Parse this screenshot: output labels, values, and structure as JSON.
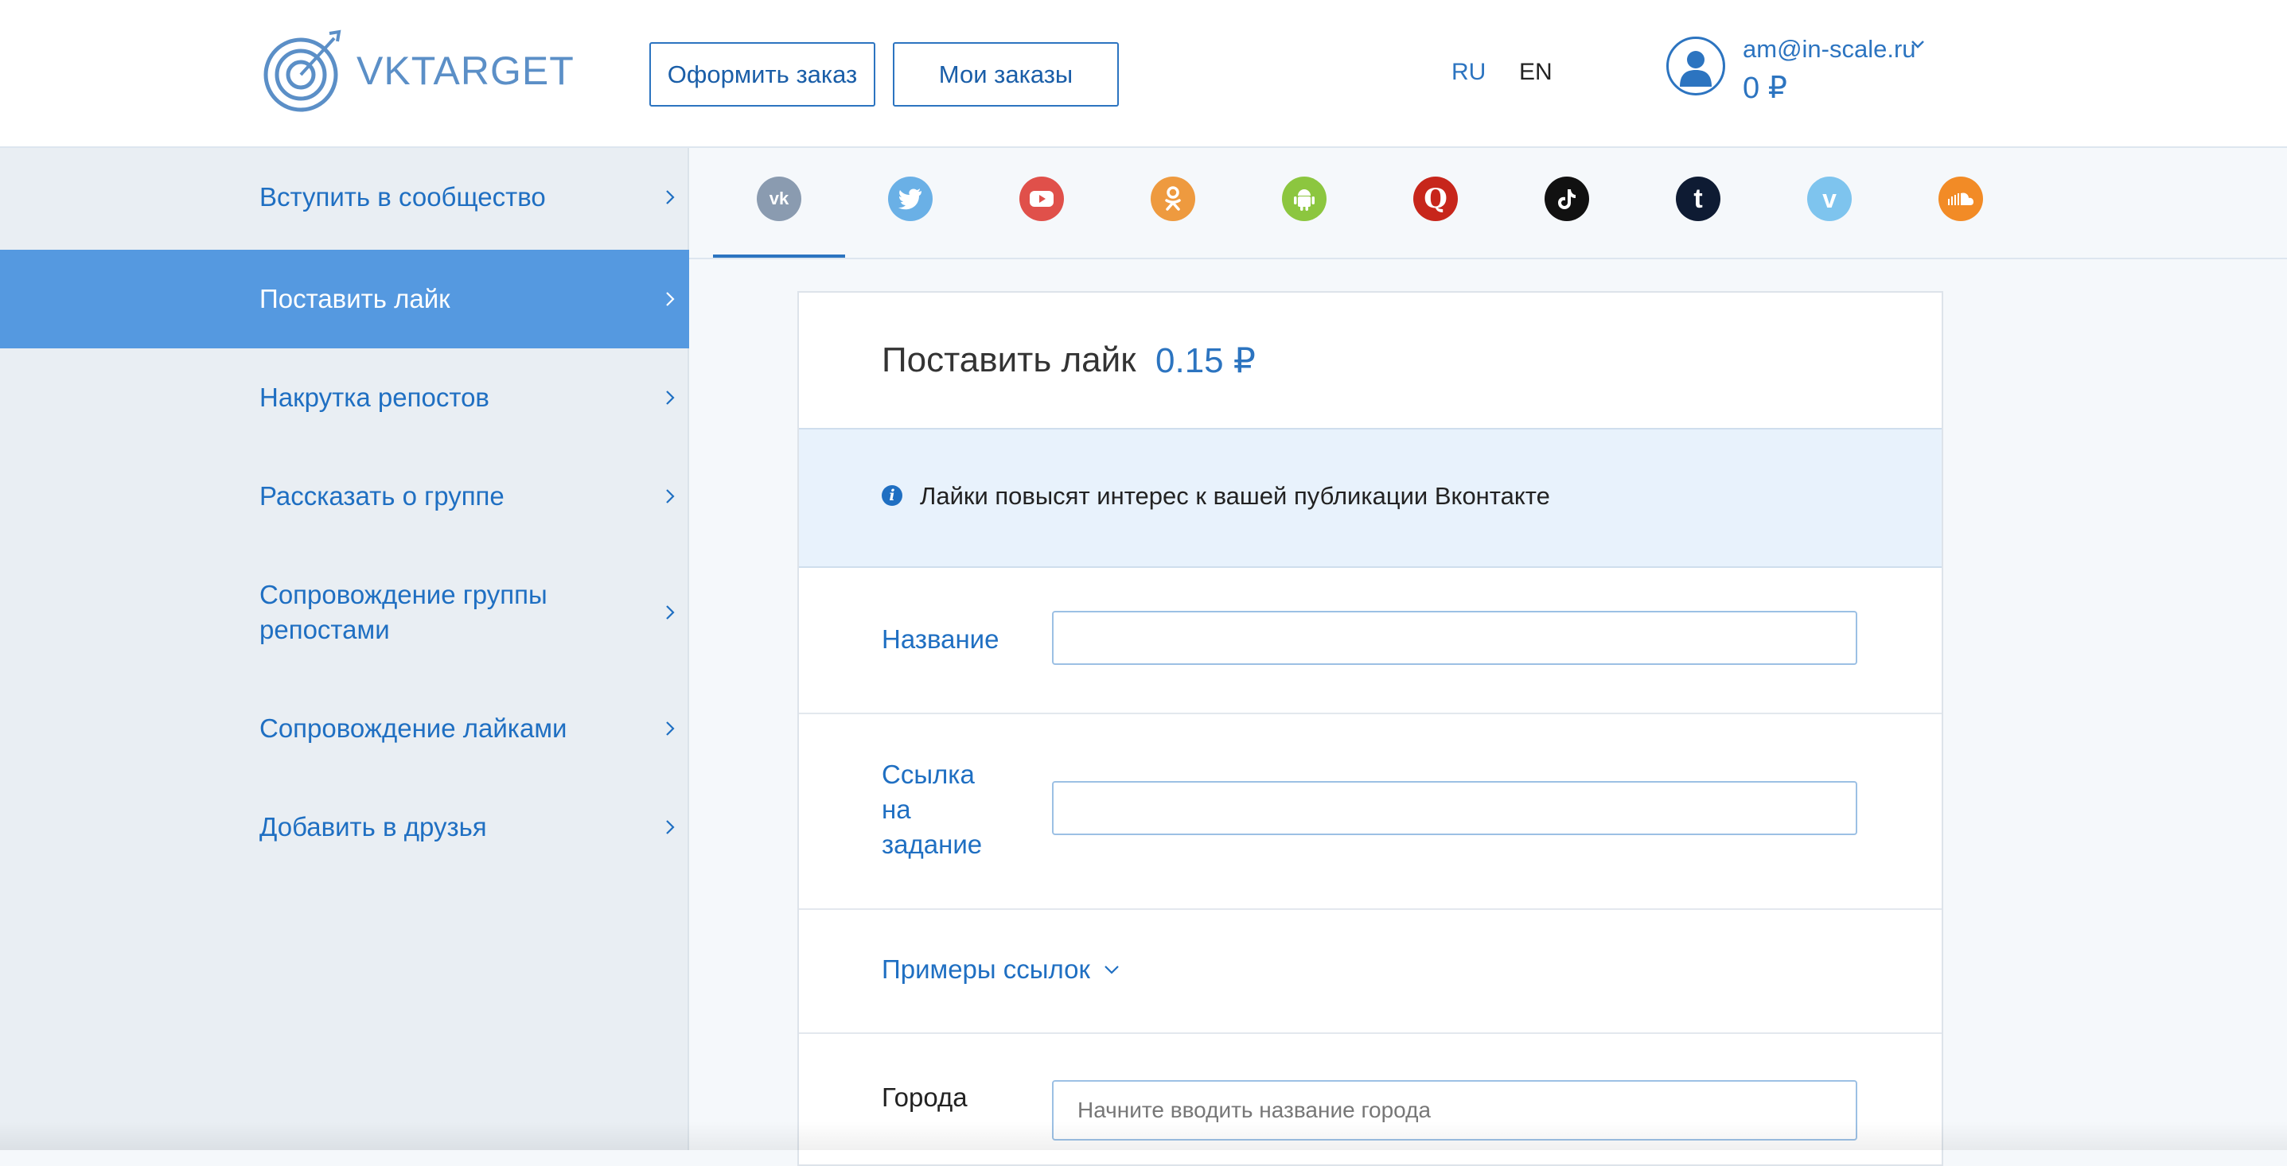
{
  "header": {
    "logo_text_vk": "VK",
    "logo_text_rest": "TARGET",
    "order_button": "Оформить заказ",
    "my_orders_button": "Мои заказы",
    "lang_ru": "RU",
    "lang_en": "EN",
    "user_email": "am@in-scale.ru",
    "user_balance": "0 ₽"
  },
  "sidebar": {
    "items": [
      {
        "label": "Вступить в сообщество",
        "active": false
      },
      {
        "label": "Поставить лайк",
        "active": true
      },
      {
        "label": "Накрутка репостов",
        "active": false
      },
      {
        "label": "Рассказать о группе",
        "active": false
      },
      {
        "label": "Сопровождение группы репостами",
        "active": false
      },
      {
        "label": "Сопровождение лайками",
        "active": false
      },
      {
        "label": "Добавить в друзья",
        "active": false
      }
    ]
  },
  "tabs": [
    {
      "name": "vk-icon",
      "color": "#8a9bb0",
      "active": true
    },
    {
      "name": "twitter-icon",
      "color": "#6ab0e6"
    },
    {
      "name": "youtube-icon",
      "color": "#e0504a"
    },
    {
      "name": "odnoklassniki-icon",
      "color": "#ee9a3f"
    },
    {
      "name": "android-icon",
      "color": "#8cc63f"
    },
    {
      "name": "quora-icon",
      "color": "#c7261b"
    },
    {
      "name": "tiktok-icon",
      "color": "#111111"
    },
    {
      "name": "tumblr-icon",
      "color": "#0e1b33"
    },
    {
      "name": "vimeo-icon",
      "color": "#7ec4ee"
    },
    {
      "name": "soundcloud-icon",
      "color": "#f28b26"
    }
  ],
  "form": {
    "title": "Поставить лайк",
    "price": "0.15 ₽",
    "info": "Лайки повысят интерес к вашей публикации Вконтакте",
    "name_label": "Название",
    "name_value": "",
    "link_label_1": "Ссылка",
    "link_label_2": "на",
    "link_label_3": "задание",
    "link_value": "",
    "examples_label": "Примеры ссылок",
    "cities_label": "Города",
    "cities_placeholder": "Начните вводить название города"
  }
}
